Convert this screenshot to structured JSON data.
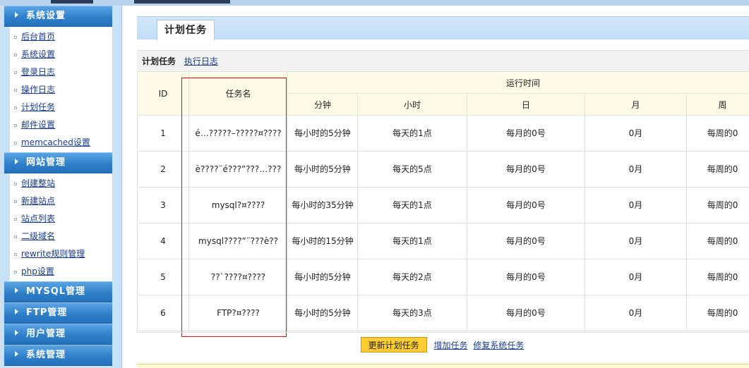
{
  "sidebar": {
    "sections": [
      {
        "label": "系统设置",
        "items": [
          "后台首页",
          "系统设置",
          "登录日志",
          "操作日志",
          "计划任务",
          "邮件设置",
          "memcached设置"
        ]
      },
      {
        "label": "网站管理",
        "items": [
          "创建整站",
          "新建站点",
          "站点列表",
          "二级域名",
          "rewrite规则管理",
          "php设置"
        ]
      },
      {
        "label": "MYSQL管理",
        "items": []
      },
      {
        "label": "FTP管理",
        "items": []
      },
      {
        "label": "用户管理",
        "items": []
      },
      {
        "label": "系统管理",
        "items": []
      }
    ]
  },
  "main": {
    "tab_title": "计划任务",
    "subtabs": {
      "current": "计划任务",
      "link": "执行日志"
    },
    "table": {
      "headers": {
        "id": "ID",
        "name": "任务名",
        "run_time": "运行时间",
        "minute": "分钟",
        "hour": "小时",
        "day": "日",
        "month": "月",
        "week": "周"
      },
      "rows": [
        {
          "id": "1",
          "name": "é…?????–?????¤????",
          "minute": "每小时的5分钟",
          "hour": "每天的1点",
          "day": "每月的0号",
          "month": "0月",
          "week": "每周的0"
        },
        {
          "id": "2",
          "name": "è????¨é???”???…???",
          "minute": "每小时的5分钟",
          "hour": "每天的5点",
          "day": "每月的0号",
          "month": "0月",
          "week": "每周的0"
        },
        {
          "id": "3",
          "name": "mysql?¤????",
          "minute": "每小时的35分钟",
          "hour": "每天的1点",
          "day": "每月的0号",
          "month": "0月",
          "week": "每周的0"
        },
        {
          "id": "4",
          "name": "mysql????”¨???è??",
          "minute": "每小时的15分钟",
          "hour": "每天的1点",
          "day": "每月的0号",
          "month": "0月",
          "week": "每周的0"
        },
        {
          "id": "5",
          "name": "??`????¤????",
          "minute": "每小时的5分钟",
          "hour": "每天的2点",
          "day": "每月的0号",
          "month": "0月",
          "week": "每周的0"
        },
        {
          "id": "6",
          "name": "FTP?¤????",
          "minute": "每小时的5分钟",
          "hour": "每天的3点",
          "day": "每月的0号",
          "month": "0月",
          "week": "每周的0"
        }
      ]
    },
    "actions": {
      "update_button": "更新计划任务",
      "add_link": "增加任务",
      "repair_link": "修复系统任务"
    }
  },
  "colors": {
    "sidebar_header": "#2f7fc9",
    "table_header_bg": "#fffbe6",
    "highlight_border": "#dd1111",
    "button_bg": "#ffcc33"
  }
}
